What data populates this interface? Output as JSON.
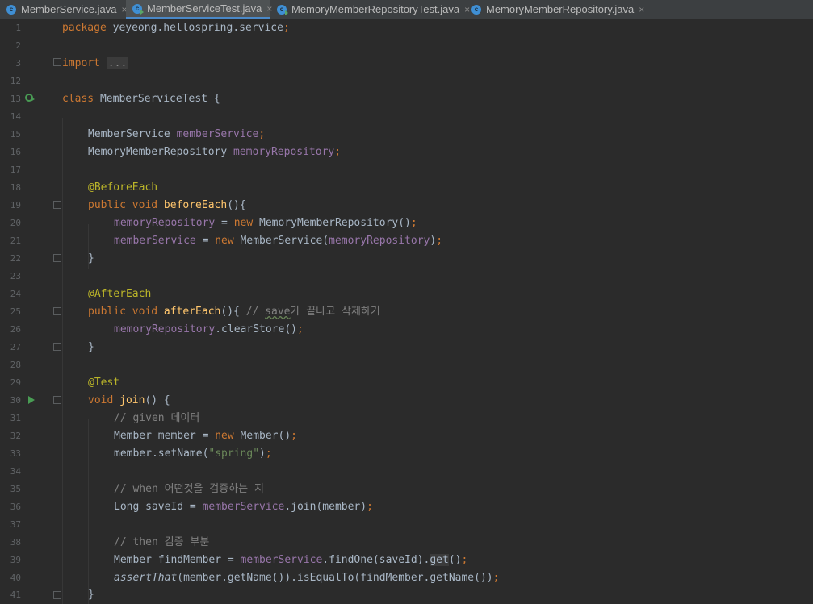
{
  "tabs": [
    {
      "label": "MemberService.java",
      "icon": "java-class-icon",
      "close": "×"
    },
    {
      "label": "MemberServiceTest.java",
      "icon": "java-test-class-icon",
      "close": "×"
    },
    {
      "label": "MemoryMemberRepositoryTest.java",
      "icon": "java-test-class-icon",
      "close": "×"
    },
    {
      "label": "MemoryMemberRepository.java",
      "icon": "java-class-icon",
      "close": "×"
    }
  ],
  "code": {
    "l1": {
      "num": "1",
      "kw": "package",
      "rest": " yeyeong.hellospring.service",
      "semi": ";"
    },
    "l2": {
      "num": "2"
    },
    "l3": {
      "num": "3",
      "kw": "import",
      "folded": "..."
    },
    "l12": {
      "num": "12"
    },
    "l13": {
      "num": "13",
      "kw": "class",
      "rest": " MemberServiceTest {"
    },
    "l14": {
      "num": "14"
    },
    "l15": {
      "num": "15",
      "type": "MemberService ",
      "field": "memberService",
      "semi": ";"
    },
    "l16": {
      "num": "16",
      "type": "MemoryMemberRepository ",
      "field": "memoryRepository",
      "semi": ";"
    },
    "l17": {
      "num": "17"
    },
    "l18": {
      "num": "18",
      "ann": "@BeforeEach"
    },
    "l19": {
      "num": "19",
      "kw": "public void ",
      "fn": "beforeEach",
      "rest": "(){"
    },
    "l20": {
      "num": "20",
      "field": "memoryRepository",
      "op": " = ",
      "kw": "new ",
      "rest": "MemoryMemberRepository()",
      "semi": ";"
    },
    "l21": {
      "num": "21",
      "field": "memberService",
      "op": " = ",
      "kw": "new ",
      "rest": "MemberService(",
      "arg": "memoryRepository",
      "close": ")",
      "semi": ";"
    },
    "l22": {
      "num": "22",
      "rest": "}"
    },
    "l23": {
      "num": "23"
    },
    "l24": {
      "num": "24",
      "ann": "@AfterEach"
    },
    "l25": {
      "num": "25",
      "kw": "public void ",
      "fn": "afterEach",
      "rest": "(){ ",
      "cmt1": "// ",
      "cmt2": "save",
      "cmt3": "가 끝나고 삭제하기"
    },
    "l26": {
      "num": "26",
      "field": "memoryRepository",
      "rest": ".clearStore()",
      "semi": ";"
    },
    "l27": {
      "num": "27",
      "rest": "}"
    },
    "l28": {
      "num": "28"
    },
    "l29": {
      "num": "29",
      "ann": "@Test"
    },
    "l30": {
      "num": "30",
      "kw": "void ",
      "fn": "join",
      "rest": "() {"
    },
    "l31": {
      "num": "31",
      "cmt": "// given 데이터"
    },
    "l32": {
      "num": "32",
      "rest": "Member member = ",
      "kw": "new ",
      "rest2": "Member()",
      "semi": ";"
    },
    "l33": {
      "num": "33",
      "rest": "member.setName(",
      "str": "\"spring\"",
      "close": ")",
      "semi": ";"
    },
    "l34": {
      "num": "34"
    },
    "l35": {
      "num": "35",
      "cmt": "// when 어떤것을 검증하는 지"
    },
    "l36": {
      "num": "36",
      "rest": "Long saveId = ",
      "field": "memberService",
      "rest2": ".join(member)",
      "semi": ";"
    },
    "l37": {
      "num": "37"
    },
    "l38": {
      "num": "38",
      "cmt": "// then 검증 부분"
    },
    "l39": {
      "num": "39",
      "rest": "Member findMember = ",
      "field": "memberService",
      "rest2": ".findOne(saveId).",
      "hl": "get",
      "close": "()",
      "semi": ";"
    },
    "l40": {
      "num": "40",
      "it": "assertThat",
      "rest": "(member.getName()).isEqualTo(findMember.getName())",
      "semi": ";"
    },
    "l41": {
      "num": "41",
      "rest": "}"
    }
  }
}
